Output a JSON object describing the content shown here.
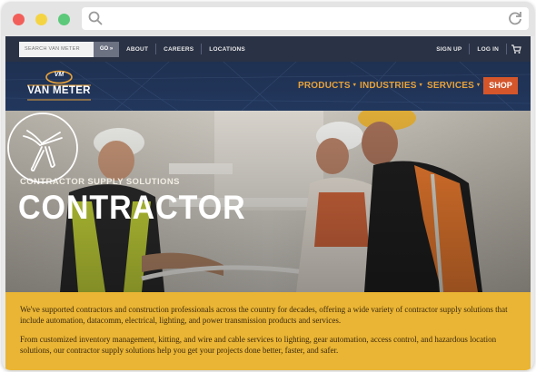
{
  "browser": {
    "url_text": ""
  },
  "utility_bar": {
    "search_placeholder": "SEARCH VAN METER",
    "go_label": "GO »",
    "links": [
      "ABOUT",
      "CAREERS",
      "LOCATIONS"
    ],
    "sign_up": "SIGN UP",
    "log_in": "LOG IN"
  },
  "header": {
    "logo_badge": "VM",
    "logo_text": "VAN METER",
    "nav": [
      {
        "label": "PRODUCTS"
      },
      {
        "label": "INDUSTRIES"
      },
      {
        "label": "SERVICES"
      }
    ],
    "shop_label": "SHOP"
  },
  "hero": {
    "eyebrow": "CONTRACTOR SUPPLY SOLUTIONS",
    "title": "CONTRACTOR"
  },
  "intro": {
    "paragraph_1": "We've supported contractors and construction professionals across the country for decades, offering a wide variety of contractor supply solutions that include automation, datacomm, electrical, lighting, and power transmission products and services.",
    "paragraph_2": "From customized inventory management, kitting, and wire and cable services to lighting, gear automation, access control, and hazardous location solutions, our contractor supply solutions help you get your projects done better, faster, and safer."
  },
  "colors": {
    "utility_bg": "#2a3245",
    "nav_bg": "#22375d",
    "nav_accent": "#e8a23a",
    "shop_bg": "#d5562b",
    "intro_bg": "#eab534"
  },
  "icons": [
    "search-icon",
    "reload-icon",
    "cart-icon",
    "caret-down-icon",
    "wire-cutter-icon"
  ]
}
